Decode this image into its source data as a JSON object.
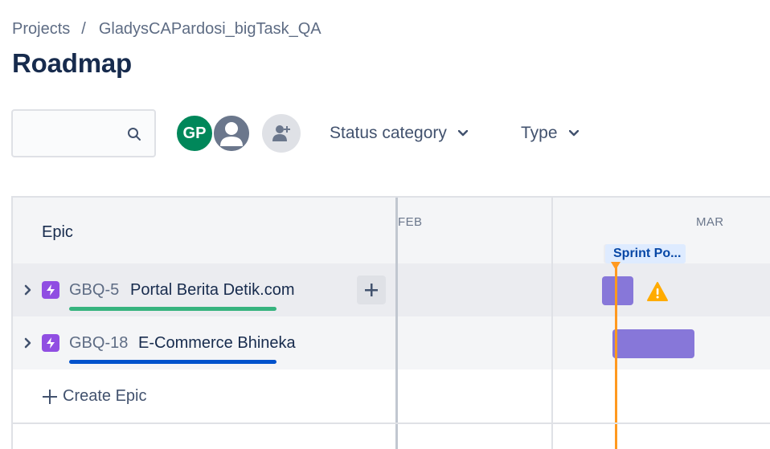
{
  "breadcrumb": {
    "items": [
      "Projects",
      "GladysCAPardosi_bigTask_QA"
    ],
    "separator": "/"
  },
  "page": {
    "title": "Roadmap"
  },
  "toolbar": {
    "search": {
      "value": "",
      "placeholder": "",
      "icon": "search-icon"
    },
    "avatars": [
      {
        "initials": "GP",
        "color": "#00875a"
      },
      {
        "initials": "",
        "color": "#6b778c",
        "icon": "user-icon"
      }
    ],
    "add_people_icon": "add-person-icon",
    "filters": [
      {
        "label": "Status category",
        "icon": "chevron-down-icon"
      },
      {
        "label": "Type",
        "icon": "chevron-down-icon"
      }
    ]
  },
  "roadmap": {
    "epic_column_header": "Epic",
    "epics": [
      {
        "key": "GBQ-5",
        "name": "Portal Berita Detik.com",
        "progress_color": "#36b37e",
        "bar_color": "#8777d9",
        "warning": true
      },
      {
        "key": "GBQ-18",
        "name": "E-Commerce Bhineka",
        "progress_color": "#0052cc",
        "bar_color": "#8777d9",
        "warning": false
      }
    ],
    "create_epic_label": "Create Epic",
    "months": [
      "FEB",
      "MAR"
    ],
    "sprint_label": "Sprint Po...",
    "colors": {
      "epic_icon": "#904ee2",
      "today_line": "#ff991f",
      "sprint_bg": "#deebff",
      "sprint_text": "#0747a6"
    }
  }
}
